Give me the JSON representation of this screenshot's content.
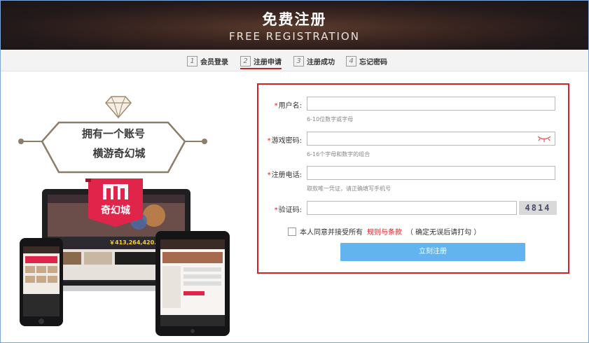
{
  "header": {
    "title": "免费注册",
    "subtitle": "FREE REGISTRATION"
  },
  "steps": [
    {
      "num": "1",
      "label": "会员登录"
    },
    {
      "num": "2",
      "label": "注册申请"
    },
    {
      "num": "3",
      "label": "注册成功"
    },
    {
      "num": "4",
      "label": "忘记密码"
    }
  ],
  "promo": {
    "line1": "拥有一个账号",
    "line2": "横游奇幻城",
    "brand": "奇幻城",
    "jackpot": "￥413,264,420.08"
  },
  "form": {
    "username": {
      "label": "用户名:",
      "value": "",
      "hint": "6-10位数字或字母"
    },
    "password": {
      "label": "游戏密码:",
      "value": "",
      "hint": "6-16个字母和数字的组合"
    },
    "phone": {
      "label": "注册电话:",
      "value": "",
      "hint": "取款唯一凭证，请正确填写手机号"
    },
    "captcha": {
      "label": "验证码:",
      "value": "",
      "image_text": "4814"
    },
    "agree": {
      "prefix": "本人同意并接受所有",
      "link": "规则与条款",
      "suffix": "（ 确定无误后请打勾 ）"
    },
    "submit": "立刻注册"
  },
  "colors": {
    "accent": "#d52222",
    "button": "#62b4ee",
    "header_bg": "#2a1d1c"
  }
}
